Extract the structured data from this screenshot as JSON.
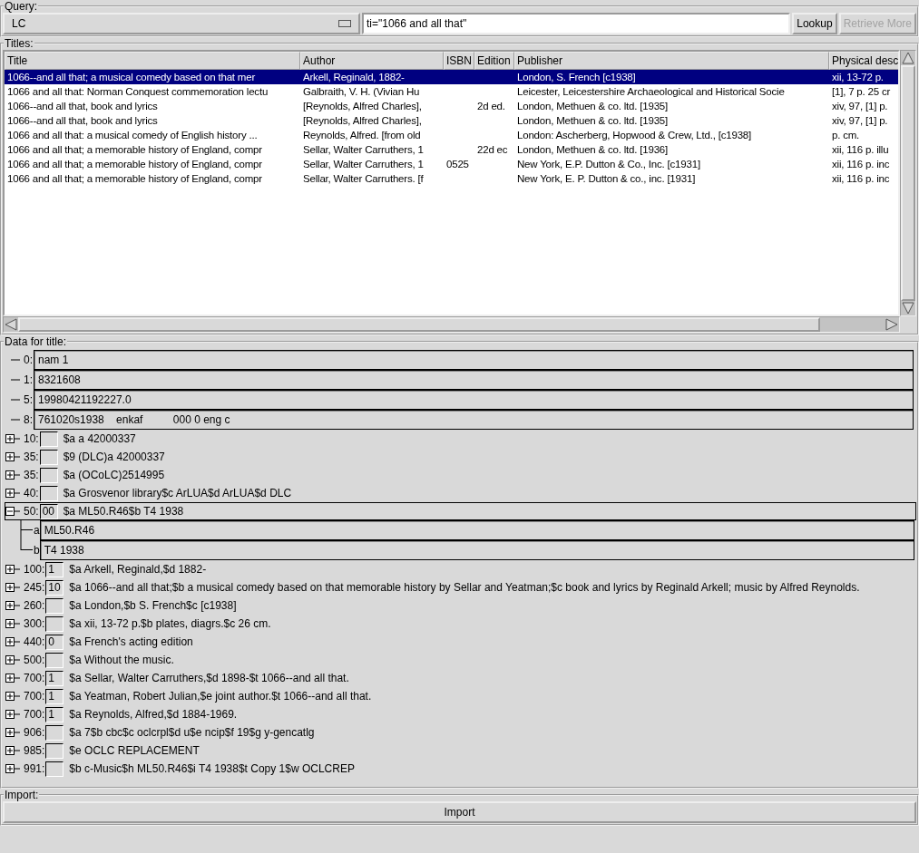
{
  "query": {
    "label": "Query:",
    "source": "LC",
    "text": "ti=\"1066 and all that\"",
    "buttons": [
      {
        "label": "Lookup",
        "disabled": false
      },
      {
        "label": "Retrieve More",
        "disabled": true
      }
    ]
  },
  "titles": {
    "label": "Titles:",
    "columns": [
      "Title",
      "Author",
      "ISBN",
      "Edition",
      "Publisher",
      "Physical desc"
    ],
    "rows": [
      {
        "selected": true,
        "cells": [
          "1066--and all that; a musical comedy based on that mer",
          "Arkell, Reginald, 1882-",
          "",
          "",
          "London, S. French [c1938]",
          "xii, 13-72 p."
        ]
      },
      {
        "selected": false,
        "cells": [
          "1066 and all that: Norman Conquest commemoration lectu",
          "Galbraith, V. H. (Vivian Hu",
          "",
          "",
          "Leicester, Leicestershire Archaeological and Historical Socie",
          "[1], 7 p. 25 cr"
        ]
      },
      {
        "selected": false,
        "cells": [
          "1066--and all that, book and lyrics",
          "[Reynolds, Alfred Charles],",
          "",
          "2d ed.",
          "London, Methuen & co. ltd. [1935]",
          "xiv, 97, [1] p."
        ]
      },
      {
        "selected": false,
        "cells": [
          "1066--and all that, book and lyrics",
          "[Reynolds, Alfred Charles],",
          "",
          "",
          "London, Methuen & co. ltd. [1935]",
          "xiv, 97, [1] p."
        ]
      },
      {
        "selected": false,
        "cells": [
          "1066 and all that: a musical comedy of English history ...",
          "Reynolds, Alfred. [from old",
          "",
          "",
          "London: Ascherberg, Hopwood & Crew, Ltd., [c1938]",
          "p. cm."
        ]
      },
      {
        "selected": false,
        "cells": [
          "1066 and all that; a memorable history of England, compr",
          "Sellar, Walter Carruthers, 1",
          "",
          "22d ec",
          "London, Methuen & co. ltd. [1936]",
          "xii, 116 p. illu"
        ]
      },
      {
        "selected": false,
        "cells": [
          "1066 and all that; a memorable history of England, compr",
          "Sellar, Walter Carruthers, 1",
          "0525",
          "",
          "New York, E.P. Dutton & Co., Inc. [c1931]",
          "xii, 116 p. inc"
        ]
      },
      {
        "selected": false,
        "cells": [
          "1066 and all that; a memorable history of England, compr",
          "Sellar, Walter Carruthers. [f",
          "",
          "",
          "New York, E. P. Dutton & co., inc. [1931]",
          "xii, 116 p. inc"
        ]
      }
    ]
  },
  "data": {
    "label": "Data for title:",
    "fields": [
      {
        "kind": "control",
        "tag": "0:",
        "value": "nam 1"
      },
      {
        "kind": "control",
        "tag": "1:",
        "value": "8321608"
      },
      {
        "kind": "control",
        "tag": "5:",
        "value": "19980421192227.0"
      },
      {
        "kind": "control",
        "tag": "8:",
        "value": "761020s1938    enkaf          000 0 eng c"
      },
      {
        "kind": "data",
        "tag": "10:",
        "expanded": false,
        "value": "$a a  42000337"
      },
      {
        "kind": "data",
        "tag": "35:",
        "expanded": false,
        "value": "$9 (DLC)a  42000337"
      },
      {
        "kind": "data",
        "tag": "35:",
        "expanded": false,
        "value": "$a (OCoLC)2514995"
      },
      {
        "kind": "data",
        "tag": "40:",
        "expanded": false,
        "value": "$a Grosvenor library$c ArLUA$d ArLUA$d DLC"
      },
      {
        "kind": "data",
        "tag": "50:",
        "expanded": true,
        "indicators": "00",
        "value": "$a ML50.R46$b T4 1938",
        "children": [
          {
            "code": "a",
            "value": "ML50.R46"
          },
          {
            "code": "b",
            "value": "T4 1938"
          }
        ]
      },
      {
        "kind": "data",
        "tag": "100:",
        "expanded": false,
        "indicators": "1",
        "value": "$a Arkell, Reginald,$d 1882-"
      },
      {
        "kind": "data",
        "tag": "245:",
        "expanded": false,
        "indicators": "10",
        "value": "$a 1066--and all that;$b a musical comedy based on that memorable history by Sellar and Yeatman;$c book and lyrics by Reginald Arkell; music by Alfred Reynolds."
      },
      {
        "kind": "data",
        "tag": "260:",
        "expanded": false,
        "value": "$a London,$b S. French$c [c1938]"
      },
      {
        "kind": "data",
        "tag": "300:",
        "expanded": false,
        "value": "$a xii, 13-72 p.$b plates, diagrs.$c 26 cm."
      },
      {
        "kind": "data",
        "tag": "440:",
        "expanded": false,
        "indicators": "0",
        "value": "$a French's acting edition"
      },
      {
        "kind": "data",
        "tag": "500:",
        "expanded": false,
        "value": "$a Without the music."
      },
      {
        "kind": "data",
        "tag": "700:",
        "expanded": false,
        "indicators": "1",
        "value": "$a Sellar, Walter Carruthers,$d 1898-$t 1066--and all that."
      },
      {
        "kind": "data",
        "tag": "700:",
        "expanded": false,
        "indicators": "1",
        "value": "$a Yeatman, Robert Julian,$e joint author.$t 1066--and all that."
      },
      {
        "kind": "data",
        "tag": "700:",
        "expanded": false,
        "indicators": "1",
        "value": "$a Reynolds, Alfred,$d 1884-1969."
      },
      {
        "kind": "data",
        "tag": "906:",
        "expanded": false,
        "value": "$a 7$b cbc$c oclcrpl$d u$e ncip$f 19$g y-gencatlg"
      },
      {
        "kind": "data",
        "tag": "985:",
        "expanded": false,
        "value": "$e OCLC REPLACEMENT"
      },
      {
        "kind": "data",
        "tag": "991:",
        "expanded": false,
        "value": "$b c-Music$h ML50.R46$i T4 1938$t Copy 1$w OCLCREP"
      }
    ]
  },
  "import": {
    "label": "Import:",
    "button": "Import"
  }
}
